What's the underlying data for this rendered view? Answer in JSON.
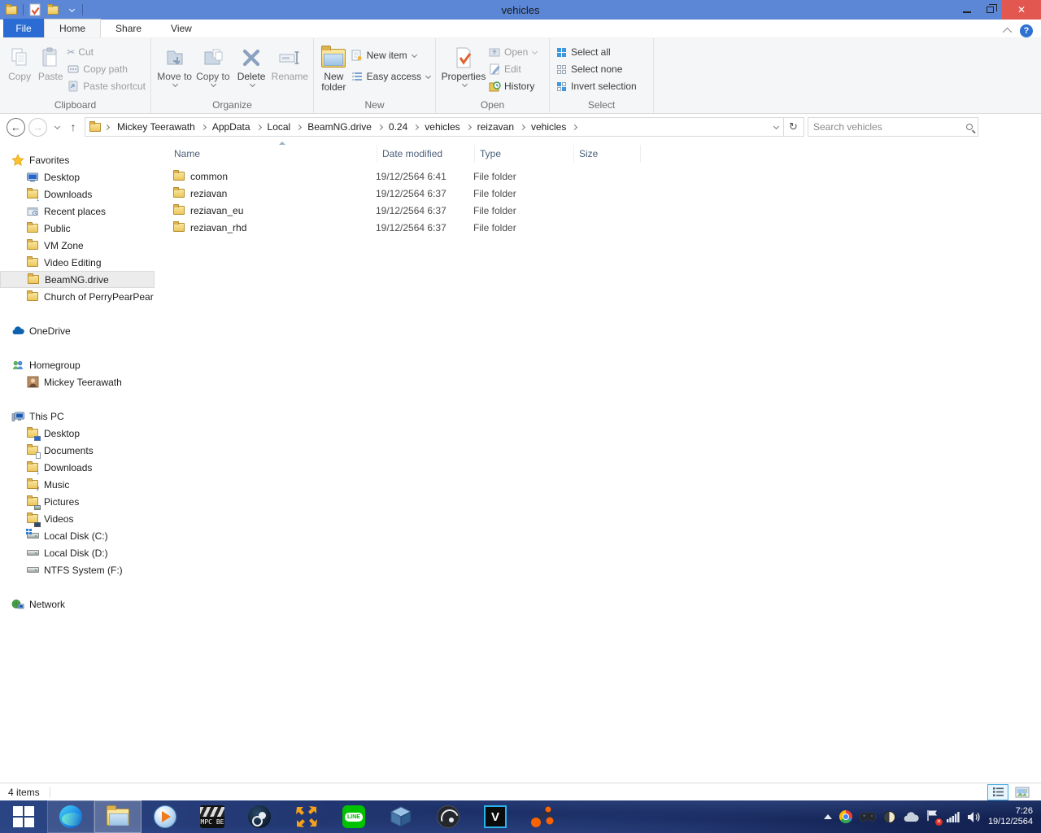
{
  "titlebar": {
    "title": "vehicles"
  },
  "tabs": {
    "file": "File",
    "home": "Home",
    "share": "Share",
    "view": "View"
  },
  "ribbon": {
    "clipboard": {
      "label": "Clipboard",
      "copy": "Copy",
      "paste": "Paste",
      "cut": "Cut",
      "copy_path": "Copy path",
      "paste_shortcut": "Paste shortcut"
    },
    "organize": {
      "label": "Organize",
      "move_to": "Move to",
      "copy_to": "Copy to",
      "delete": "Delete",
      "rename": "Rename"
    },
    "new": {
      "label": "New",
      "new_folder": "New folder",
      "new_item": "New item",
      "easy_access": "Easy access"
    },
    "open_group": {
      "label": "Open",
      "properties": "Properties",
      "open": "Open",
      "edit": "Edit",
      "history": "History"
    },
    "select": {
      "label": "Select",
      "select_all": "Select all",
      "select_none": "Select none",
      "invert": "Invert selection"
    }
  },
  "address": {
    "breadcrumb": [
      "Mickey Teerawath",
      "AppData",
      "Local",
      "BeamNG.drive",
      "0.24",
      "vehicles",
      "reizavan",
      "vehicles"
    ],
    "search_placeholder": "Search vehicles"
  },
  "sidebar": {
    "favorites": {
      "label": "Favorites",
      "items": [
        "Desktop",
        "Downloads",
        "Recent places",
        "Public",
        "VM Zone",
        "Video Editing",
        "BeamNG.drive",
        "Church of PerryPearPear"
      ],
      "selected": "BeamNG.drive"
    },
    "onedrive": {
      "label": "OneDrive"
    },
    "homegroup": {
      "label": "Homegroup",
      "items": [
        "Mickey Teerawath"
      ]
    },
    "thispc": {
      "label": "This PC",
      "items": [
        "Desktop",
        "Documents",
        "Downloads",
        "Music",
        "Pictures",
        "Videos",
        "Local Disk (C:)",
        "Local Disk (D:)",
        "NTFS System (F:)"
      ]
    },
    "network": {
      "label": "Network"
    }
  },
  "filelist": {
    "columns": [
      "Name",
      "Date modified",
      "Type",
      "Size"
    ],
    "rows": [
      {
        "name": "common",
        "date": "19/12/2564 6:41",
        "type": "File folder",
        "size": ""
      },
      {
        "name": "reziavan",
        "date": "19/12/2564 6:37",
        "type": "File folder",
        "size": ""
      },
      {
        "name": "reziavan_eu",
        "date": "19/12/2564 6:37",
        "type": "File folder",
        "size": ""
      },
      {
        "name": "reziavan_rhd",
        "date": "19/12/2564 6:37",
        "type": "File folder",
        "size": ""
      }
    ]
  },
  "statusbar": {
    "count": "4 items"
  },
  "taskbar": {
    "line_label": "LINE",
    "mpcbe_label": "MPC BE",
    "vegas_label": "V",
    "clock": {
      "time": "7:26",
      "date": "19/12/2564"
    }
  },
  "icons": {
    "back_arrow": "←",
    "up_arrow": "↑",
    "refresh": "↻",
    "scissors": "✂",
    "down_arrow": "↓",
    "music_note": "♪",
    "help": "?",
    "close": "✕",
    "minimize": ""
  },
  "colors": {
    "titlebar_blue": "#5b87d6",
    "file_tab_blue": "#2a6cd3",
    "close_red": "#e25750",
    "folder_yellow": "#ecc65b",
    "selection_border": "#41a8dd"
  }
}
